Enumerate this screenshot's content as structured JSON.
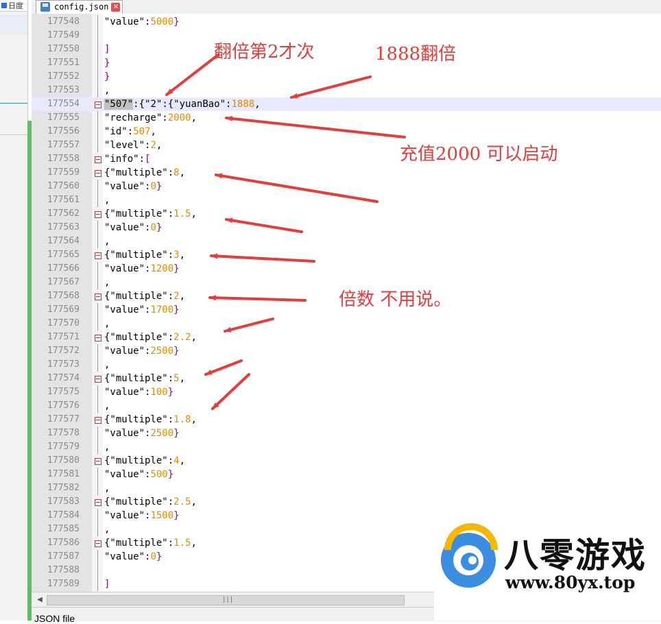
{
  "file_tab": {
    "name": "config.json"
  },
  "left_pane": {
    "tab_text": "日度"
  },
  "status": {
    "filetype": "JSON file"
  },
  "colors": {
    "number": "#e68a00",
    "bracket": "#8b008b",
    "annotation": "#e53c3c",
    "current_line": "#e8e8ff"
  },
  "editor": {
    "lines": [
      {
        "no": "177548",
        "parts": [
          {
            "t": "\"value\":",
            "c": ""
          },
          {
            "t": "5000",
            "c": "n"
          },
          {
            "t": "}",
            "c": "p"
          }
        ]
      },
      {
        "no": "177549",
        "parts": []
      },
      {
        "no": "177550",
        "parts": [
          {
            "t": "]",
            "c": "p"
          }
        ]
      },
      {
        "no": "177551",
        "parts": [
          {
            "t": "}",
            "c": "p"
          }
        ]
      },
      {
        "no": "177552",
        "parts": [
          {
            "t": "}",
            "c": "p"
          }
        ]
      },
      {
        "no": "177553",
        "parts": [
          {
            "t": ",",
            "c": ""
          }
        ]
      },
      {
        "no": "177554",
        "fold": true,
        "current": true,
        "parts": [
          {
            "t": "\"507\"",
            "c": "hl"
          },
          {
            "t": ":{",
            "c": ""
          },
          {
            "t": "\"2\"",
            "c": ""
          },
          {
            "t": ":{",
            "c": ""
          },
          {
            "t": "\"yuanBao\":",
            "c": ""
          },
          {
            "t": "1888",
            "c": "n"
          },
          {
            "t": ",",
            "c": ""
          }
        ]
      },
      {
        "no": "177555",
        "parts": [
          {
            "t": "\"recharge\":",
            "c": ""
          },
          {
            "t": "2000",
            "c": "n"
          },
          {
            "t": ",",
            "c": ""
          }
        ]
      },
      {
        "no": "177556",
        "parts": [
          {
            "t": "\"id\":",
            "c": ""
          },
          {
            "t": "507",
            "c": "n"
          },
          {
            "t": ",",
            "c": ""
          }
        ]
      },
      {
        "no": "177557",
        "parts": [
          {
            "t": "\"level\":",
            "c": ""
          },
          {
            "t": "2",
            "c": "n"
          },
          {
            "t": ",",
            "c": ""
          }
        ]
      },
      {
        "no": "177558",
        "fold": true,
        "parts": [
          {
            "t": "\"info\":",
            "c": ""
          },
          {
            "t": "[",
            "c": "p"
          }
        ]
      },
      {
        "no": "177559",
        "fold": true,
        "parts": [
          {
            "t": "{\"multiple\":",
            "c": ""
          },
          {
            "t": "8",
            "c": "n"
          },
          {
            "t": ",",
            "c": ""
          }
        ]
      },
      {
        "no": "177560",
        "parts": [
          {
            "t": "\"value\":",
            "c": ""
          },
          {
            "t": "0",
            "c": "n"
          },
          {
            "t": "}",
            "c": "p"
          }
        ]
      },
      {
        "no": "177561",
        "parts": [
          {
            "t": ",",
            "c": ""
          }
        ]
      },
      {
        "no": "177562",
        "fold": true,
        "parts": [
          {
            "t": "{\"multiple\":",
            "c": ""
          },
          {
            "t": "1.5",
            "c": "n"
          },
          {
            "t": ",",
            "c": ""
          }
        ]
      },
      {
        "no": "177563",
        "parts": [
          {
            "t": "\"value\":",
            "c": ""
          },
          {
            "t": "0",
            "c": "n"
          },
          {
            "t": "}",
            "c": "p"
          }
        ]
      },
      {
        "no": "177564",
        "parts": [
          {
            "t": ",",
            "c": ""
          }
        ]
      },
      {
        "no": "177565",
        "fold": true,
        "parts": [
          {
            "t": "{\"multiple\":",
            "c": ""
          },
          {
            "t": "3",
            "c": "n"
          },
          {
            "t": ",",
            "c": ""
          }
        ]
      },
      {
        "no": "177566",
        "parts": [
          {
            "t": "\"value\":",
            "c": ""
          },
          {
            "t": "1200",
            "c": "n"
          },
          {
            "t": "}",
            "c": "p"
          }
        ]
      },
      {
        "no": "177567",
        "parts": [
          {
            "t": ",",
            "c": ""
          }
        ]
      },
      {
        "no": "177568",
        "fold": true,
        "parts": [
          {
            "t": "{\"multiple\":",
            "c": ""
          },
          {
            "t": "2",
            "c": "n"
          },
          {
            "t": ",",
            "c": ""
          }
        ]
      },
      {
        "no": "177569",
        "parts": [
          {
            "t": "\"value\":",
            "c": ""
          },
          {
            "t": "1700",
            "c": "n"
          },
          {
            "t": "}",
            "c": "p"
          }
        ]
      },
      {
        "no": "177570",
        "parts": [
          {
            "t": ",",
            "c": ""
          }
        ]
      },
      {
        "no": "177571",
        "fold": true,
        "parts": [
          {
            "t": "{\"multiple\":",
            "c": ""
          },
          {
            "t": "2.2",
            "c": "n"
          },
          {
            "t": ",",
            "c": ""
          }
        ]
      },
      {
        "no": "177572",
        "parts": [
          {
            "t": "\"value\":",
            "c": ""
          },
          {
            "t": "2500",
            "c": "n"
          },
          {
            "t": "}",
            "c": "p"
          }
        ]
      },
      {
        "no": "177573",
        "parts": [
          {
            "t": ",",
            "c": ""
          }
        ]
      },
      {
        "no": "177574",
        "fold": true,
        "parts": [
          {
            "t": "{\"multiple\":",
            "c": ""
          },
          {
            "t": "5",
            "c": "n"
          },
          {
            "t": ",",
            "c": ""
          }
        ]
      },
      {
        "no": "177575",
        "parts": [
          {
            "t": "\"value\":",
            "c": ""
          },
          {
            "t": "100",
            "c": "n"
          },
          {
            "t": "}",
            "c": "p"
          }
        ]
      },
      {
        "no": "177576",
        "parts": [
          {
            "t": ",",
            "c": ""
          }
        ]
      },
      {
        "no": "177577",
        "fold": true,
        "parts": [
          {
            "t": "{\"multiple\":",
            "c": ""
          },
          {
            "t": "1.8",
            "c": "n"
          },
          {
            "t": ",",
            "c": ""
          }
        ]
      },
      {
        "no": "177578",
        "parts": [
          {
            "t": "\"value\":",
            "c": ""
          },
          {
            "t": "2500",
            "c": "n"
          },
          {
            "t": "}",
            "c": "p"
          }
        ]
      },
      {
        "no": "177579",
        "parts": [
          {
            "t": ",",
            "c": ""
          }
        ]
      },
      {
        "no": "177580",
        "fold": true,
        "parts": [
          {
            "t": "{\"multiple\":",
            "c": ""
          },
          {
            "t": "4",
            "c": "n"
          },
          {
            "t": ",",
            "c": ""
          }
        ]
      },
      {
        "no": "177581",
        "parts": [
          {
            "t": "\"value\":",
            "c": ""
          },
          {
            "t": "500",
            "c": "n"
          },
          {
            "t": "}",
            "c": "p"
          }
        ]
      },
      {
        "no": "177582",
        "parts": [
          {
            "t": ",",
            "c": ""
          }
        ]
      },
      {
        "no": "177583",
        "fold": true,
        "parts": [
          {
            "t": "{\"multiple\":",
            "c": ""
          },
          {
            "t": "2.5",
            "c": "n"
          },
          {
            "t": ",",
            "c": ""
          }
        ]
      },
      {
        "no": "177584",
        "parts": [
          {
            "t": "\"value\":",
            "c": ""
          },
          {
            "t": "1500",
            "c": "n"
          },
          {
            "t": "}",
            "c": "p"
          }
        ]
      },
      {
        "no": "177585",
        "parts": [
          {
            "t": ",",
            "c": ""
          }
        ]
      },
      {
        "no": "177586",
        "fold": true,
        "parts": [
          {
            "t": "{\"multiple\":",
            "c": ""
          },
          {
            "t": "1.5",
            "c": "n"
          },
          {
            "t": ",",
            "c": ""
          }
        ]
      },
      {
        "no": "177587",
        "parts": [
          {
            "t": "\"value\":",
            "c": ""
          },
          {
            "t": "0",
            "c": "n"
          },
          {
            "t": "}",
            "c": "p"
          }
        ]
      },
      {
        "no": "177588",
        "parts": []
      },
      {
        "no": "177589",
        "parts": [
          {
            "t": "]",
            "c": "p"
          }
        ]
      }
    ]
  },
  "annotations": {
    "double_2nd": "翻倍第2才次",
    "double_1888": "1888翻倍",
    "recharge": "充值2000 可以启动",
    "multiple": "倍数 不用说。"
  },
  "watermark": {
    "brand": "八零游戏",
    "url": "www.80yx.top"
  }
}
